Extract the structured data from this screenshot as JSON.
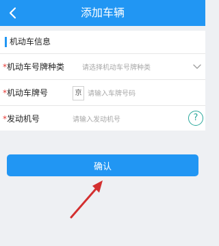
{
  "header": {
    "title": "添加车辆",
    "back_icon": "chevron-left-icon"
  },
  "section": {
    "title": "机动车信息"
  },
  "form": {
    "plate_type": {
      "required_mark": "*",
      "label": "机动车号牌种类",
      "placeholder": "请选择机动车号牌种类",
      "icon": "chevron-down-icon"
    },
    "plate_number": {
      "required_mark": "*",
      "label": "机动车牌号",
      "prefix": "京",
      "placeholder": "请输入车牌号码"
    },
    "engine_number": {
      "required_mark": "*",
      "label": "发动机号",
      "placeholder": "请输入发动机号",
      "help_label": "?"
    }
  },
  "confirm_button": {
    "label": "确认"
  },
  "annotation": {
    "icon": "red-arrow-icon",
    "color": "#d32f2f"
  },
  "colors": {
    "primary": "#2196f3",
    "required": "#e53935",
    "help": "#26a69a"
  }
}
